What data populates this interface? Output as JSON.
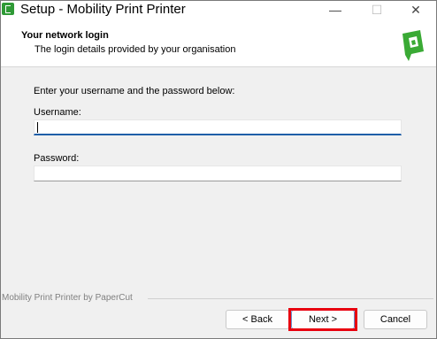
{
  "window": {
    "title": "Setup - Mobility Print Printer",
    "controls": {
      "minimize": "—",
      "maximize": "☐",
      "close": "✕"
    }
  },
  "header": {
    "title": "Your network login",
    "subtitle": "The login details provided by your organisation",
    "logo_color": "#3aaa35"
  },
  "form": {
    "instruction": "Enter your username and the password below:",
    "username_label": "Username:",
    "username_value": "",
    "password_label": "Password:",
    "password_value": ""
  },
  "footer": {
    "branding": "Mobility Print Printer by PaperCut",
    "back_label": "< Back",
    "next_label": "Next >",
    "cancel_label": "Cancel"
  },
  "colors": {
    "highlight": "#e8000f",
    "focus_underline": "#1f5fa8"
  }
}
